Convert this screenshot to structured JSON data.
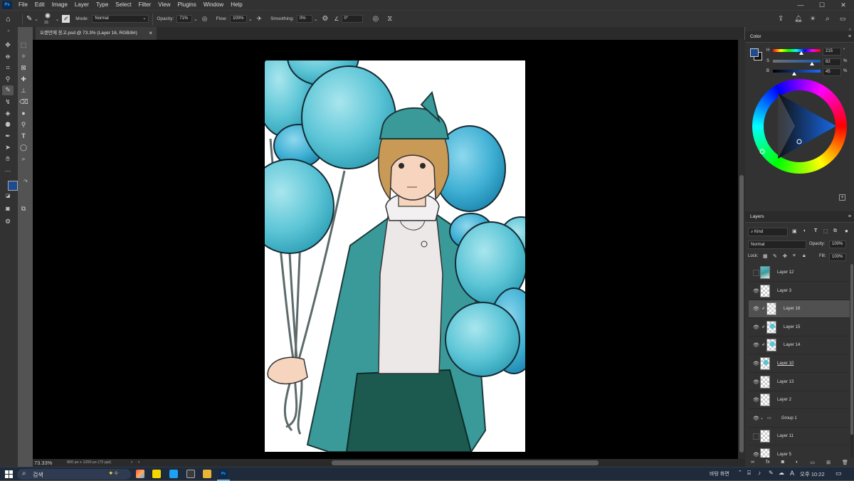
{
  "app": {
    "logo": "Ps"
  },
  "menu": [
    "File",
    "Edit",
    "Image",
    "Layer",
    "Type",
    "Select",
    "Filter",
    "View",
    "Plugins",
    "Window",
    "Help"
  ],
  "window_controls": {
    "minimize": "—",
    "maximize": "☐",
    "close": "✕"
  },
  "options": {
    "brush_size": "15",
    "mode_label": "Mode:",
    "mode_value": "Normal",
    "opacity_label": "Opacity:",
    "opacity_value": "71%",
    "flow_label": "Flow:",
    "flow_value": "100%",
    "smoothing_label": "Smoothing:",
    "smoothing_value": "0%",
    "angle_value": "0°"
  },
  "document_tab": {
    "title": "오랜만에 옹고.psd @ 73.3% (Layer 16, RGB/8#)",
    "close": "×"
  },
  "status": {
    "zoom": "73.33%",
    "doc_info": "800 px x 1200 px (72 ppi)"
  },
  "color_panel": {
    "title": "Color",
    "h_label": "H",
    "h_value": "215",
    "s_label": "S",
    "s_value": "82",
    "b_label": "B",
    "b_value": "45",
    "unit_deg": "°",
    "unit_pct_s": "%",
    "unit_pct_b": "%",
    "h_level": 0.597,
    "s_level": 0.82,
    "b_level": 0.45,
    "foreground": "#1e4a8f",
    "background": "#111111"
  },
  "layers_panel": {
    "title": "Layers",
    "filter_label": "Kind",
    "blend_mode": "Normal",
    "opacity_label": "Opacity:",
    "opacity_value": "100%",
    "lock_label": "Lock:",
    "fill_label": "Fill:",
    "fill_value": "100%",
    "layers": [
      {
        "name": "Layer 12",
        "visible": false,
        "clipped": false,
        "selected": false,
        "thumb": "photo"
      },
      {
        "name": "Layer 3",
        "visible": true,
        "clipped": false,
        "selected": false,
        "thumb": "blank"
      },
      {
        "name": "Layer 16",
        "visible": true,
        "clipped": true,
        "selected": true,
        "thumb": "blank"
      },
      {
        "name": "Layer 15",
        "visible": true,
        "clipped": true,
        "selected": false,
        "thumb": "teal"
      },
      {
        "name": "Layer 14",
        "visible": true,
        "clipped": true,
        "selected": false,
        "thumb": "teal"
      },
      {
        "name": "Layer 10",
        "visible": true,
        "clipped": false,
        "selected": false,
        "thumb": "teal"
      },
      {
        "name": "Layer 13",
        "visible": true,
        "clipped": false,
        "selected": false,
        "thumb": "blank"
      },
      {
        "name": "Layer 2",
        "visible": true,
        "clipped": false,
        "selected": false,
        "thumb": "blank"
      },
      {
        "name": "Group 1",
        "visible": true,
        "clipped": false,
        "selected": false,
        "thumb": "group"
      },
      {
        "name": "Layer 11",
        "visible": false,
        "clipped": false,
        "selected": false,
        "thumb": "blank"
      },
      {
        "name": "Layer 5",
        "visible": true,
        "clipped": false,
        "selected": false,
        "thumb": "blank"
      }
    ]
  },
  "taskbar": {
    "search_placeholder": "검색",
    "tray_text": "바탕 화면",
    "ime": "A",
    "clock": "오후 10:22"
  }
}
